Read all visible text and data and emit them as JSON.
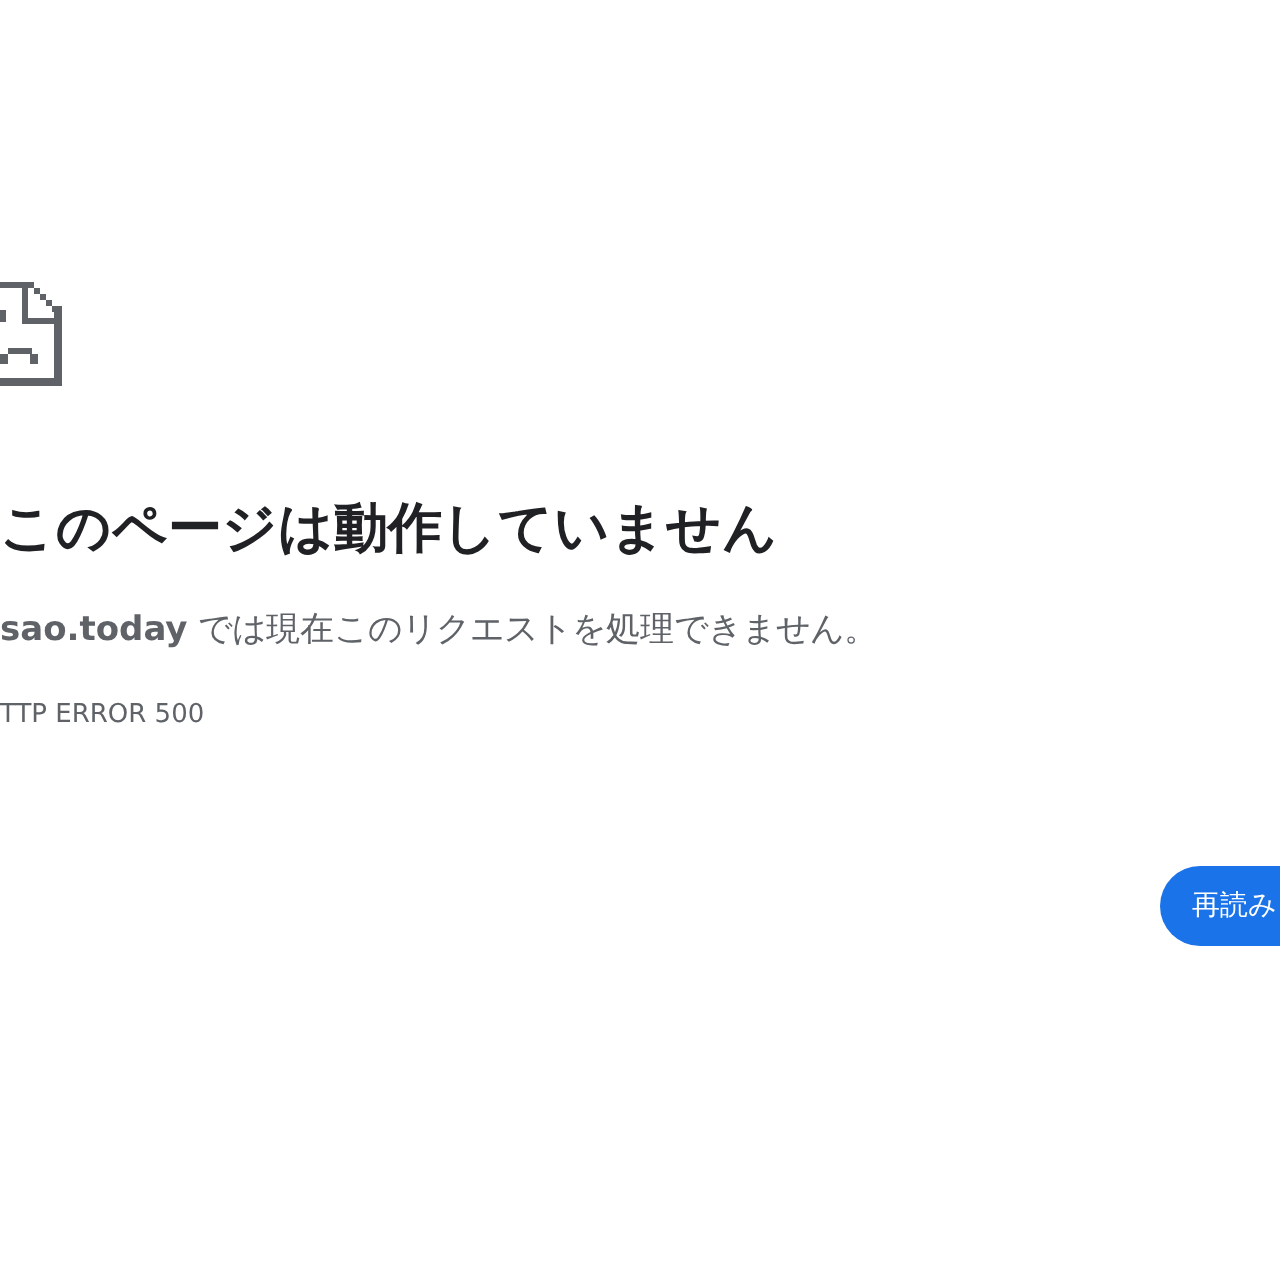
{
  "error_page": {
    "title": "このページは動作していません",
    "message": "**sao.today** では現在このリクエストを処理できません。",
    "error_code": "TTP ERROR 500"
  },
  "buttons": [
    {
      "label": "再読み"
    }
  ]
}
